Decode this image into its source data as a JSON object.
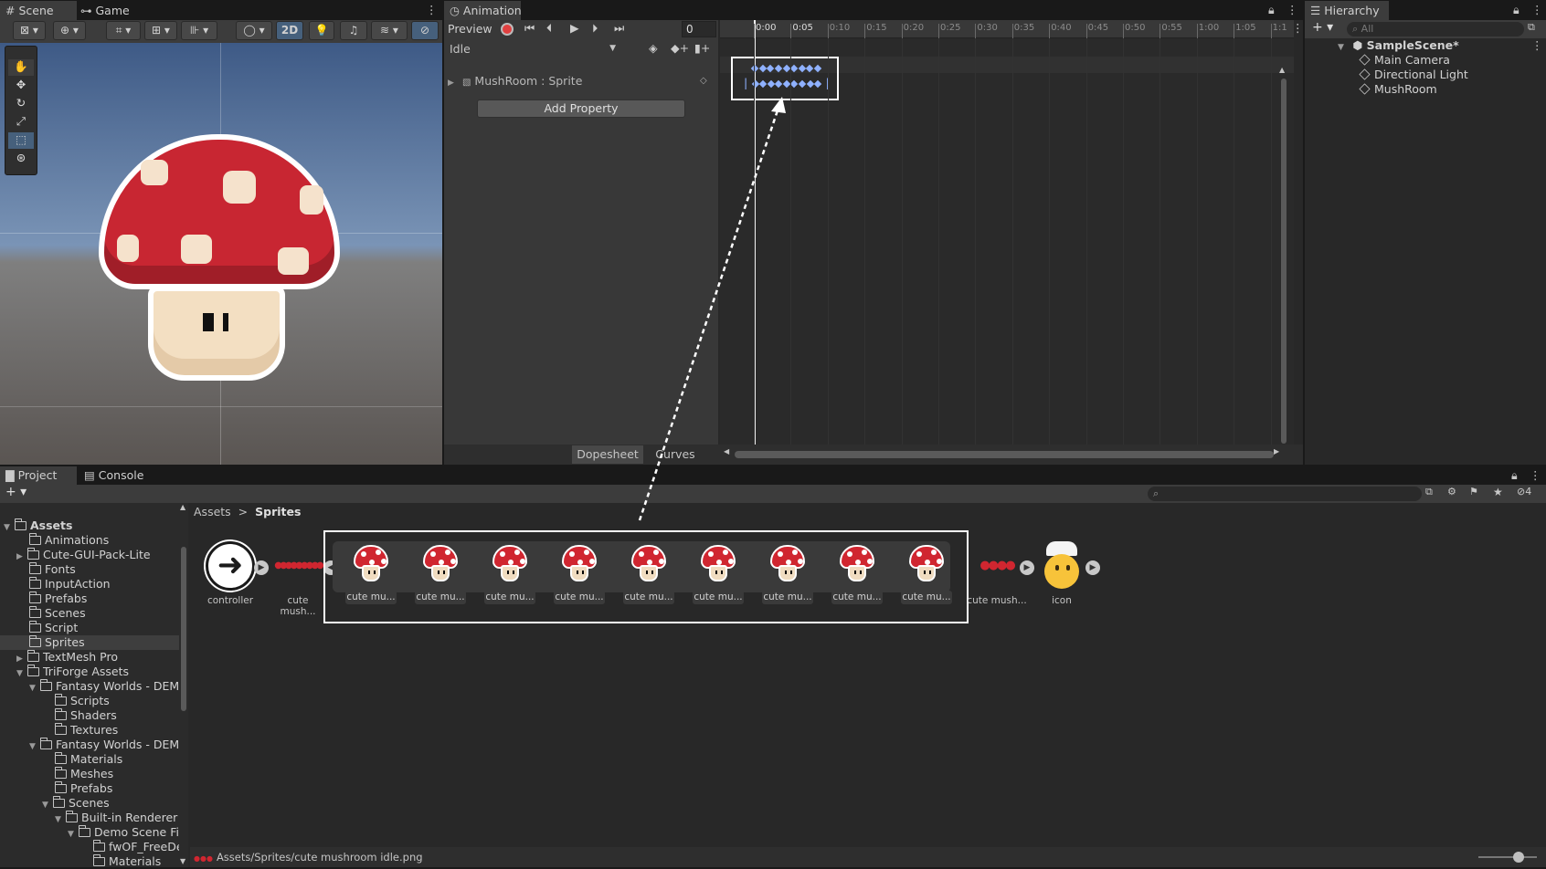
{
  "scene_panel": {
    "tabs": [
      {
        "label": "Scene"
      },
      {
        "label": "Game"
      }
    ],
    "toolbar": {
      "mode_2d": "2D"
    }
  },
  "animation_panel": {
    "tab_label": "Animation",
    "preview_label": "Preview",
    "frame_value": "0",
    "clip_name": "Idle",
    "property_label": "MushRoom : Sprite",
    "add_property_label": "Add Property",
    "timeline_labels": [
      "0:00",
      "0:05",
      "0:10",
      "0:15",
      "0:20",
      "0:25",
      "0:30",
      "0:35",
      "0:40",
      "0:45",
      "0:50",
      "0:55",
      "1:00",
      "1:05",
      "1:1"
    ],
    "bottom_tabs": [
      {
        "label": "Dopesheet"
      },
      {
        "label": "Curves"
      }
    ]
  },
  "hierarchy_panel": {
    "tab_label": "Hierarchy",
    "search_placeholder": "All",
    "scene_name": "SampleScene*",
    "items": [
      {
        "label": "Main Camera"
      },
      {
        "label": "Directional Light"
      },
      {
        "label": "MushRoom"
      }
    ]
  },
  "project_panel": {
    "tabs": [
      {
        "label": "Project"
      },
      {
        "label": "Console"
      }
    ],
    "hidden_count": "4",
    "breadcrumb": {
      "root": "Assets",
      "separator": ">",
      "current": "Sprites"
    },
    "tree": {
      "root": "Assets",
      "items": [
        {
          "label": "Animations"
        },
        {
          "label": "Cute-GUI-Pack-Lite"
        },
        {
          "label": "Fonts"
        },
        {
          "label": "InputAction"
        },
        {
          "label": "Prefabs"
        },
        {
          "label": "Scenes"
        },
        {
          "label": "Script"
        },
        {
          "label": "Sprites"
        },
        {
          "label": "TextMesh Pro"
        },
        {
          "label": "TriForge Assets"
        },
        {
          "label": "Fantasy Worlds - DEMO"
        },
        {
          "label": "Scripts"
        },
        {
          "label": "Shaders"
        },
        {
          "label": "Textures"
        },
        {
          "label": "Fantasy Worlds - DEMO"
        },
        {
          "label": "Materials"
        },
        {
          "label": "Meshes"
        },
        {
          "label": "Prefabs"
        },
        {
          "label": "Scenes"
        },
        {
          "label": "Built-in Renderer"
        },
        {
          "label": "Demo Scene Files"
        },
        {
          "label": "fwOF_FreeDemo"
        },
        {
          "label": "Materials"
        }
      ]
    },
    "assets": {
      "controller": "controller",
      "sheet_collapsed": "cute mush...",
      "frames": [
        "cute mu...",
        "cute mu...",
        "cute mu...",
        "cute mu...",
        "cute mu...",
        "cute mu...",
        "cute mu...",
        "cute mu...",
        "cute mu..."
      ],
      "sheet2": "cute mush...",
      "icon": "icon"
    },
    "status_path": "Assets/Sprites/cute mushroom idle.png"
  },
  "colors": {
    "accent_keyframe": "#8fb1ff",
    "highlight_box": "#ffffff",
    "mushroom_red": "#d02630"
  }
}
